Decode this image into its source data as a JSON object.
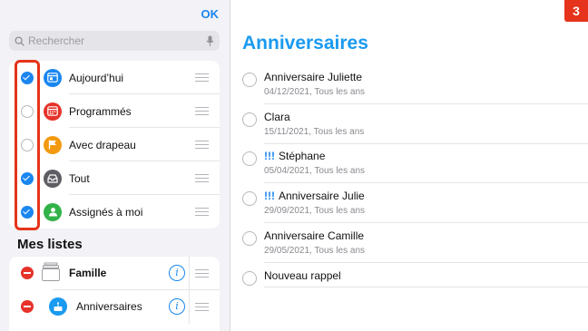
{
  "sidebar": {
    "ok_label": "OK",
    "search_placeholder": "Rechercher",
    "smart_lists": [
      {
        "label": "Aujourd’hui",
        "checked": true,
        "icon": "calendar-today-icon",
        "color": "#1a86f0"
      },
      {
        "label": "Programmés",
        "checked": false,
        "icon": "calendar-scheduled-icon",
        "color": "#e6332a"
      },
      {
        "label": "Avec drapeau",
        "checked": false,
        "icon": "flag-icon",
        "color": "#f29a0f"
      },
      {
        "label": "Tout",
        "checked": true,
        "icon": "tray-icon",
        "color": "#5d5d63"
      },
      {
        "label": "Assignés à moi",
        "checked": true,
        "icon": "person-icon",
        "color": "#33b249"
      }
    ],
    "section_title": "Mes listes",
    "lists": [
      {
        "label": "Famille",
        "bold": true,
        "icon": "group-stack-icon"
      },
      {
        "label": "Anniversaires",
        "bold": false,
        "icon": "birthday-cake-icon",
        "color": "#1a9af0"
      }
    ]
  },
  "main": {
    "title": "Anniversaires",
    "reminders": [
      {
        "title": "Anniversaire Juliette",
        "priority": "",
        "subtitle": "04/12/2021, Tous les ans"
      },
      {
        "title": "Clara",
        "priority": "",
        "subtitle": "15/11/2021, Tous les ans"
      },
      {
        "title": "Stéphane",
        "priority": "!!!",
        "subtitle": "05/04/2021, Tous les ans"
      },
      {
        "title": "Anniversaire Julie",
        "priority": "!!!",
        "subtitle": "29/09/2021, Tous les ans"
      },
      {
        "title": "Anniversaire Camille",
        "priority": "",
        "subtitle": "29/05/2021, Tous les ans"
      },
      {
        "title": "Nouveau rappel",
        "priority": "",
        "subtitle": ""
      }
    ],
    "badge": "3"
  },
  "colors": {
    "accent": "#1a86f0",
    "title": "#1a9af0",
    "highlight": "#e5341b"
  }
}
